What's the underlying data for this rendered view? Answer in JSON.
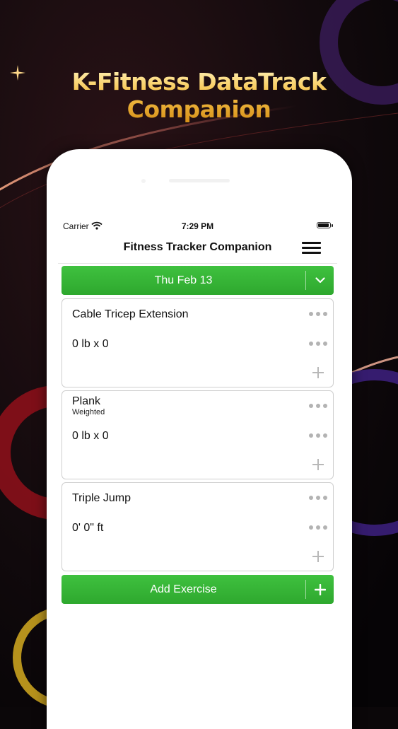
{
  "promo": {
    "headline": "K-Fitness DataTrack Companion"
  },
  "status_bar": {
    "carrier": "Carrier",
    "time": "7:29 PM"
  },
  "nav": {
    "title": "Fitness Tracker Companion",
    "menu_icon": "hamburger-menu-icon"
  },
  "date_picker": {
    "label": "Thu Feb 13",
    "icon": "chevron-down-icon"
  },
  "exercises": [
    {
      "name": "Cable Tricep Extension",
      "subtitle": "",
      "set": "0 lb x 0"
    },
    {
      "name": "Plank",
      "subtitle": "Weighted",
      "set": "0 lb x 0"
    },
    {
      "name": "Triple Jump",
      "subtitle": "",
      "set": "0' 0\" ft"
    }
  ],
  "add_exercise": {
    "label": "Add Exercise",
    "icon": "plus-icon"
  },
  "colors": {
    "accent_green": "#34b034",
    "headline_gold": "#f6c24a"
  }
}
